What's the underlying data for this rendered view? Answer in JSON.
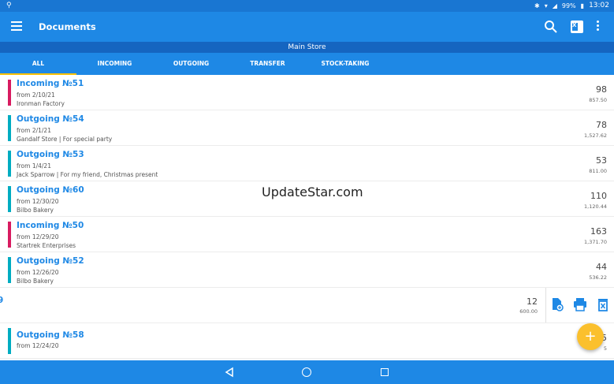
{
  "status_bar": {
    "battery": "99%",
    "time": "13:02"
  },
  "app_bar": {
    "title": "Documents"
  },
  "store": {
    "name": "Main Store"
  },
  "tabs": [
    {
      "label": "ALL",
      "active": true
    },
    {
      "label": "INCOMING",
      "active": false
    },
    {
      "label": "OUTGOING",
      "active": false
    },
    {
      "label": "TRANSFER",
      "active": false
    },
    {
      "label": "STOCK-TAKING",
      "active": false
    }
  ],
  "documents": [
    {
      "title": "Incoming №51",
      "date": "from 2/10/21",
      "party": "Ironman Factory",
      "qty": "98",
      "amount": "857.50",
      "type_color": "#d81b60"
    },
    {
      "title": "Outgoing №54",
      "date": "from 2/1/21",
      "party": "Gandalf Store | For special party",
      "qty": "78",
      "amount": "1,527.62",
      "type_color": "#00acc1"
    },
    {
      "title": "Outgoing №53",
      "date": "from 1/4/21",
      "party": "Jack Sparrow  | For my friend, Christmas present",
      "qty": "53",
      "amount": "811.00",
      "type_color": "#00acc1"
    },
    {
      "title": "Outgoing №60",
      "date": "from 12/30/20",
      "party": "Bilbo Bakery",
      "qty": "110",
      "amount": "1,120.44",
      "type_color": "#00acc1"
    },
    {
      "title": "Incoming №50",
      "date": "from 12/29/20",
      "party": "Startrek Enterprises",
      "qty": "163",
      "amount": "1,371.70",
      "type_color": "#d81b60"
    },
    {
      "title": "Outgoing №52",
      "date": "from 12/26/20",
      "party": "Bilbo Bakery",
      "qty": "44",
      "amount": "536.22",
      "type_color": "#00acc1"
    }
  ],
  "swiped_row": {
    "title_fragment": "9",
    "qty": "12",
    "amount": "600.00"
  },
  "partial_row": {
    "title": "Outgoing №58",
    "date": "from 12/24/20",
    "qty_fragment": "5",
    "amount_fragment": "5",
    "type_color": "#00acc1"
  },
  "watermark": "UpdateStar.com",
  "fab": {
    "label": "+"
  },
  "colors": {
    "primary": "#1e88e5",
    "primary_dark": "#1565c0",
    "accent": "#fbc02d",
    "incoming": "#d81b60",
    "outgoing": "#00acc1"
  }
}
